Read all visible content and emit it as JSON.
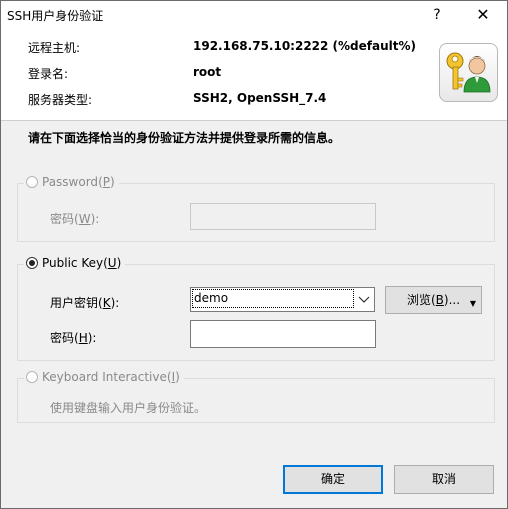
{
  "window": {
    "title": "SSH用户身份验证",
    "help_glyph": "?",
    "close_glyph": "✕"
  },
  "header": {
    "rows": [
      {
        "label": "远程主机:",
        "value": "192.168.75.10:2222 (%default%)"
      },
      {
        "label": "登录名:",
        "value": "root"
      },
      {
        "label": "服务器类型:",
        "value": "SSH2, OpenSSH_7.4"
      }
    ],
    "icon": "key-user-icon"
  },
  "instruction": "请在下面选择恰当的身份验证方法并提供登录所需的信息。",
  "password_group": {
    "label": "Password",
    "mnemonic": "P",
    "selected": false,
    "enabled": false,
    "field_label": "密码",
    "field_mnemonic": "W",
    "field_value": ""
  },
  "publickey_group": {
    "label": "Public Key",
    "mnemonic": "U",
    "selected": true,
    "enabled": true,
    "key_label": "用户密钥",
    "key_mnemonic": "K",
    "key_value": "demo",
    "browse_label": "浏览",
    "browse_mnemonic": "B",
    "browse_suffix": "...",
    "passphrase_label": "密码",
    "passphrase_mnemonic": "H",
    "passphrase_value": ""
  },
  "keyboard_group": {
    "label": "Keyboard Interactive",
    "mnemonic": "I",
    "selected": false,
    "enabled": false,
    "description": "使用键盘输入用户身份验证。"
  },
  "buttons": {
    "ok": "确定",
    "cancel": "取消"
  },
  "colors": {
    "accent": "#0078d7",
    "disabled_text": "#8a8a8a",
    "dialog_bg": "#f0f0f0"
  }
}
